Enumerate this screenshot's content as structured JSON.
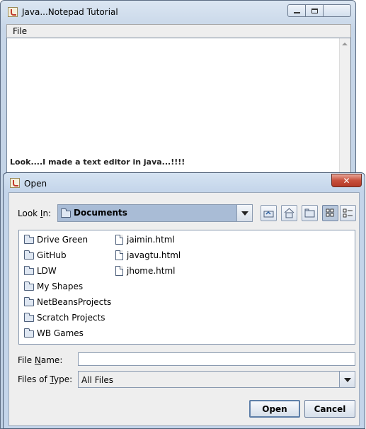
{
  "main_window": {
    "title": "Java...Notepad Tutorial",
    "menu": {
      "file": "File"
    },
    "editor_text": "Look....I made a text editor in java...!!!!"
  },
  "dialog": {
    "title": "Open",
    "close_glyph": "✕",
    "look_in": {
      "label_prefix": "Look ",
      "label_mnemonic": "I",
      "label_suffix": "n:",
      "value": "Documents"
    },
    "toolbar_icons": [
      "up-one-level-icon",
      "home-icon",
      "new-folder-icon",
      "list-view-icon",
      "details-view-icon"
    ],
    "folders": [
      "Drive Green",
      "GitHub",
      "LDW",
      "My Shapes",
      "NetBeansProjects",
      "Scratch Projects",
      "WB Games"
    ],
    "files": [
      "jaimin.html",
      "javagtu.html",
      "jhome.html"
    ],
    "file_name": {
      "label_prefix": "File ",
      "label_mnemonic": "N",
      "label_suffix": "ame:",
      "value": ""
    },
    "files_of_type": {
      "label_prefix": "Files of ",
      "label_mnemonic": "T",
      "label_suffix": "ype:",
      "value": "All Files"
    },
    "buttons": {
      "open": "Open",
      "cancel": "Cancel"
    }
  },
  "colors": {
    "title_gradient": "#c7d6e8",
    "combo_selected": "#a9bcd6",
    "close_red": "#c74f3c"
  }
}
